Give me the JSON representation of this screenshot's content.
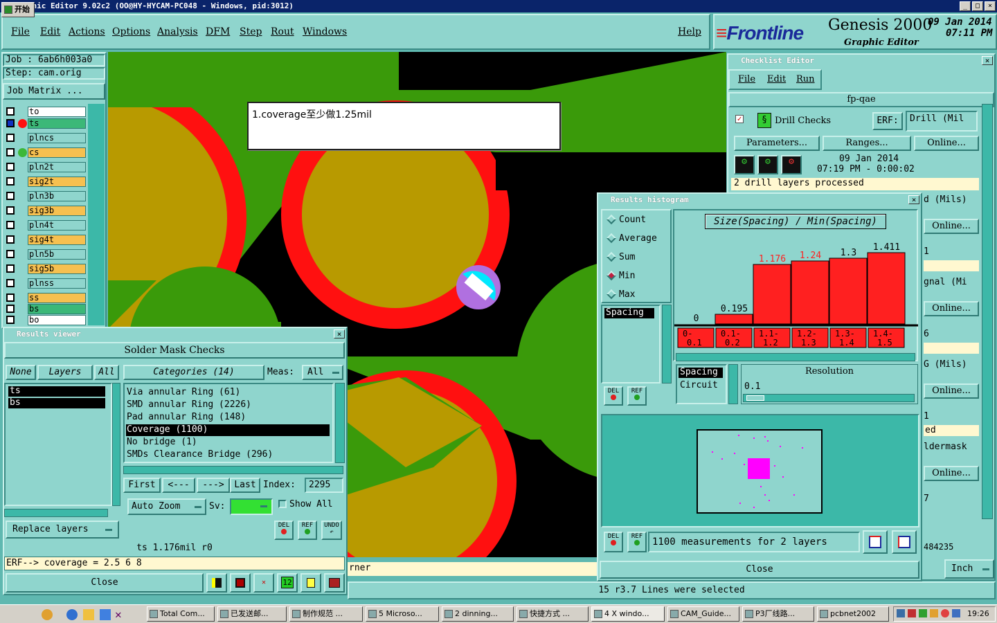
{
  "window": {
    "title": "Graphic Editor 9.02c2 (OO@HY-HYCAM-PC048 - Windows, pid:3012)"
  },
  "menu": {
    "file": "File",
    "edit": "Edit",
    "actions": "Actions",
    "options": "Options",
    "analysis": "Analysis",
    "dfm": "DFM",
    "step": "Step",
    "rout": "Rout",
    "windows": "Windows",
    "help": "Help"
  },
  "brand": {
    "logo": "Frontline",
    "product": "Genesis 2000",
    "subtitle": "Graphic Editor",
    "date": "09 Jan 2014",
    "time": "07:11 PM"
  },
  "job": {
    "job_label": "Job : 6ab6h003a0",
    "step_label": "Step: cam.orig",
    "matrix_button": "Job Matrix ..."
  },
  "layers": [
    {
      "name": "to",
      "color": "#ffffff"
    },
    {
      "name": "ts",
      "color": "#3cb878"
    },
    {
      "name": "plncs",
      "color": "#8fd5cd"
    },
    {
      "name": "cs",
      "color": "#f6c050"
    },
    {
      "name": "pln2t",
      "color": "#8fd5cd"
    },
    {
      "name": "sig2t",
      "color": "#f6c050"
    },
    {
      "name": "pln3b",
      "color": "#8fd5cd"
    },
    {
      "name": "sig3b",
      "color": "#f6c050"
    },
    {
      "name": "pln4t",
      "color": "#8fd5cd"
    },
    {
      "name": "sig4t",
      "color": "#f6c050"
    },
    {
      "name": "pln5b",
      "color": "#8fd5cd"
    },
    {
      "name": "sig5b",
      "color": "#f6c050"
    },
    {
      "name": "plnss",
      "color": "#8fd5cd"
    },
    {
      "name": "ss",
      "color": "#f6c050"
    },
    {
      "name": "bs",
      "color": "#3cb878"
    },
    {
      "name": "bo",
      "color": "#ffffff"
    }
  ],
  "annotation": {
    "text": "1.coverage至少做1.25mil"
  },
  "results_viewer": {
    "title": "Results viewer",
    "header": "Solder Mask Checks",
    "none": "None",
    "layers": "Layers",
    "all": "All",
    "categories_label": "Categories (14)",
    "meas_label": "Meas:",
    "meas_value": "All",
    "layer_list": [
      "ts",
      "bs"
    ],
    "categories": [
      "Via annular Ring (61)",
      "SMD annular Ring (2226)",
      "Pad annular Ring (148)",
      "Coverage (1100)",
      "No bridge (1)",
      "SMDs Clearance Bridge (296)"
    ],
    "first": "First",
    "prev": "<---",
    "next": "--->",
    "last": "Last",
    "index_label": "Index:",
    "index_value": "2295",
    "auto_zoom": "Auto Zoom",
    "sv_label": "Sv:",
    "show_all": "Show All",
    "replace_layers": "Replace layers",
    "del": "DEL",
    "ref": "REF",
    "undo": "UNDO",
    "status": "ts 1.176mil  r0",
    "erf": "ERF--> coverage = 2.5 6 8",
    "close": "Close"
  },
  "checklist": {
    "title": "Checklist Editor",
    "file": "File",
    "edit": "Edit",
    "run": "Run",
    "name": "fp-qae",
    "drill_checks": "Drill Checks",
    "erf": "ERF:",
    "erf_value": "Drill (Mil",
    "parameters": "Parameters...",
    "ranges": "Ranges...",
    "online": "Online...",
    "run_date": "09 Jan 2014",
    "run_time": "07:19 PM - 0:00:02",
    "status": "2 drill layers processed",
    "partial_labels": [
      "d (Mils)",
      "1",
      "gnal (Mi",
      "6",
      "G (Mils)",
      "1",
      "ed",
      "ldermask",
      "7"
    ],
    "partial_bottom": "484235"
  },
  "histogram": {
    "title": "Results histogram",
    "options": [
      "Count",
      "Average",
      "Sum",
      "Min",
      "Max"
    ],
    "selected": "Min",
    "chart_title": "Size(Spacing) / Min(Spacing)",
    "list_selected": "Spacing",
    "spacing_label": "Spacing",
    "circuit_label": "Circuit",
    "resolution_label": "Resolution",
    "resolution_value": "0.1",
    "measurements": "1100 measurements for 2 layers",
    "close": "Close",
    "del": "DEL",
    "ref": "REF"
  },
  "chart_data": {
    "type": "bar",
    "title": "Size(Spacing) / Min(Spacing)",
    "categories": [
      "0-0.1",
      "0.1-0.2",
      "1.1-1.2",
      "1.2-1.3",
      "1.3-1.4",
      "1.4-1.5"
    ],
    "bin_labels": [
      [
        "0-",
        "0.1"
      ],
      [
        "0.1-",
        "0.2"
      ],
      [
        "1.1-",
        "1.2"
      ],
      [
        "1.2-",
        "1.3"
      ],
      [
        "1.3-",
        "1.4"
      ],
      [
        "1.4-",
        "1.5"
      ]
    ],
    "values": [
      0,
      0.195,
      1.176,
      1.24,
      1.3,
      1.411
    ],
    "value_labels": [
      "0",
      "0.195",
      "1.176",
      "1.24",
      "1.3",
      "1.411"
    ],
    "highlight": [
      false,
      false,
      true,
      true,
      false,
      false
    ],
    "ylim": [
      0,
      1.5
    ],
    "bar_color": "#ff2020",
    "label_color_normal": "#000000",
    "label_color_highlight": "#ff2020"
  },
  "statusbar": {
    "corner_text": "rner",
    "message": "15 r3.7 Lines were selected",
    "units": "Inch"
  },
  "taskbar": {
    "start": "开始",
    "items": [
      "Total Com...",
      "已发送邮...",
      "制作规范 ...",
      "5 Microso...",
      "2 dinning...",
      "快捷方式 ...",
      "4 X windo...",
      "CAM_Guide...",
      "P3厂线路...",
      "pcbnet2002"
    ],
    "clock": "19:26"
  }
}
